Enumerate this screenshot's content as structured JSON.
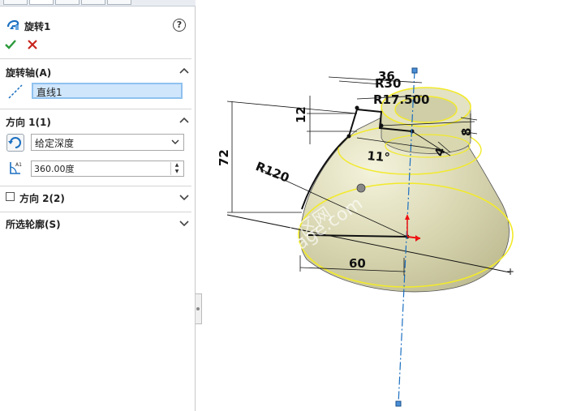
{
  "feature": {
    "title": "旋转1",
    "help_label": "?"
  },
  "axis_section": {
    "title": "旋转轴(A)",
    "value": "直线1"
  },
  "direction1_section": {
    "title": "方向 1(1)",
    "end_condition": "给定深度",
    "angle": "360.00度",
    "angle_icon_text": "A1"
  },
  "direction2_section": {
    "title": "方向 2(2)"
  },
  "contours_section": {
    "title": "所选轮廓(S)"
  },
  "dimensions": {
    "d36": "36",
    "dR30": "R30",
    "dR17": "R17.500",
    "d12": "12",
    "d8": "8",
    "d4": "4",
    "d11": "11°",
    "d72": "72",
    "dR120": "R120",
    "d60": "60"
  },
  "watermark": {
    "line1": "机械社区网",
    "line2": "www.i...age.com"
  },
  "colors": {
    "accent_blue": "#1b6fc1",
    "ok_green": "#2a9a3a",
    "cancel_red": "#c8241b",
    "model_fill": "#d8d7b0",
    "edge_yellow": "#f2ea2a"
  }
}
